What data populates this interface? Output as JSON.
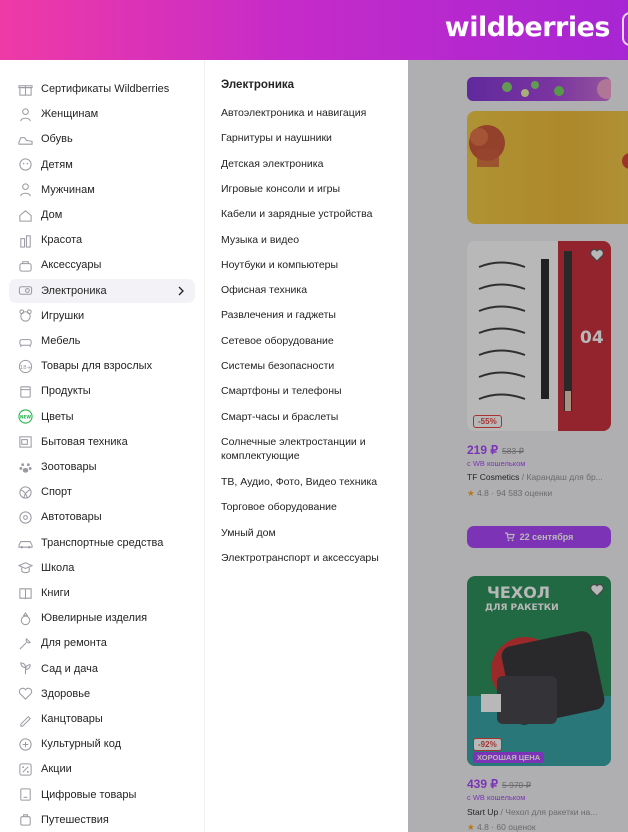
{
  "header": {
    "logo": "wildberries"
  },
  "sidebar": {
    "items": [
      {
        "label": "Сертификаты Wildberries",
        "icon": "gift-icon"
      },
      {
        "label": "Женщинам",
        "icon": "woman-icon"
      },
      {
        "label": "Обувь",
        "icon": "shoe-icon"
      },
      {
        "label": "Детям",
        "icon": "baby-icon"
      },
      {
        "label": "Мужчинам",
        "icon": "man-icon"
      },
      {
        "label": "Дом",
        "icon": "home-icon"
      },
      {
        "label": "Красота",
        "icon": "beauty-icon"
      },
      {
        "label": "Аксессуары",
        "icon": "bag-icon"
      },
      {
        "label": "Электроника",
        "icon": "electronics-icon",
        "active": true
      },
      {
        "label": "Игрушки",
        "icon": "toy-icon"
      },
      {
        "label": "Мебель",
        "icon": "furniture-icon"
      },
      {
        "label": "Товары для взрослых",
        "icon": "adult-18-icon"
      },
      {
        "label": "Продукты",
        "icon": "food-icon"
      },
      {
        "label": "Цветы",
        "icon": "new-badge-icon"
      },
      {
        "label": "Бытовая техника",
        "icon": "appliance-icon"
      },
      {
        "label": "Зоотовары",
        "icon": "paw-icon"
      },
      {
        "label": "Спорт",
        "icon": "ball-icon"
      },
      {
        "label": "Автотовары",
        "icon": "car-parts-icon"
      },
      {
        "label": "Транспортные средства",
        "icon": "car-icon"
      },
      {
        "label": "Школа",
        "icon": "school-icon"
      },
      {
        "label": "Книги",
        "icon": "book-icon"
      },
      {
        "label": "Ювелирные изделия",
        "icon": "ring-icon"
      },
      {
        "label": "Для ремонта",
        "icon": "tool-icon"
      },
      {
        "label": "Сад и дача",
        "icon": "garden-icon"
      },
      {
        "label": "Здоровье",
        "icon": "heart-health-icon"
      },
      {
        "label": "Канцтовары",
        "icon": "stationery-icon"
      },
      {
        "label": "Культурный код",
        "icon": "culture-icon"
      },
      {
        "label": "Акции",
        "icon": "percent-icon"
      },
      {
        "label": "Цифровые товары",
        "icon": "digital-icon"
      },
      {
        "label": "Путешествия",
        "icon": "travel-icon"
      }
    ]
  },
  "subpanel": {
    "title": "Электроника",
    "items": [
      "Автоэлектроника и навигация",
      "Гарнитуры и наушники",
      "Детская электроника",
      "Игровые консоли и игры",
      "Кабели и зарядные устройства",
      "Музыка и видео",
      "Ноутбуки и компьютеры",
      "Офисная техника",
      "Развлечения и гаджеты",
      "Сетевое оборудование",
      "Системы безопасности",
      "Смартфоны и телефоны",
      "Смарт-часы и браслеты",
      "Солнечные электростанции и комплектующие",
      "ТВ, Аудио, Фото, Видео техника",
      "Торговое оборудование",
      "Умный дом",
      "Электротранспорт и аксессуары"
    ]
  },
  "products": [
    {
      "discount": "-55%",
      "price": "219 ₽",
      "old_price": "583 ₽",
      "wallet": "с WB кошельком",
      "brand": "TF Cosmetics",
      "name": " / Карандаш для бр...",
      "rating": "4.8",
      "reviews": "· 94 583 оценки",
      "image_text": "04"
    },
    {
      "discount": "-92%",
      "good_price": "ХОРОШАЯ ЦЕНА",
      "price": "439 ₽",
      "old_price": "5 970 ₽",
      "wallet": "с WB кошельком",
      "brand": "Start Up",
      "name": " / Чехол для ракетки на...",
      "rating": "4.8",
      "reviews": "· 60 оценок",
      "image_text_1": "ЧЕХОЛ",
      "image_text_2": "ДЛЯ РАКЕТКИ"
    }
  ],
  "cart_button": {
    "label": "22 сентября"
  },
  "colors": {
    "accent": "#a73afd",
    "header_start": "#ef3aa6",
    "header_end": "#a726d3",
    "discount": "#e53935",
    "star": "#ff9e0d"
  }
}
